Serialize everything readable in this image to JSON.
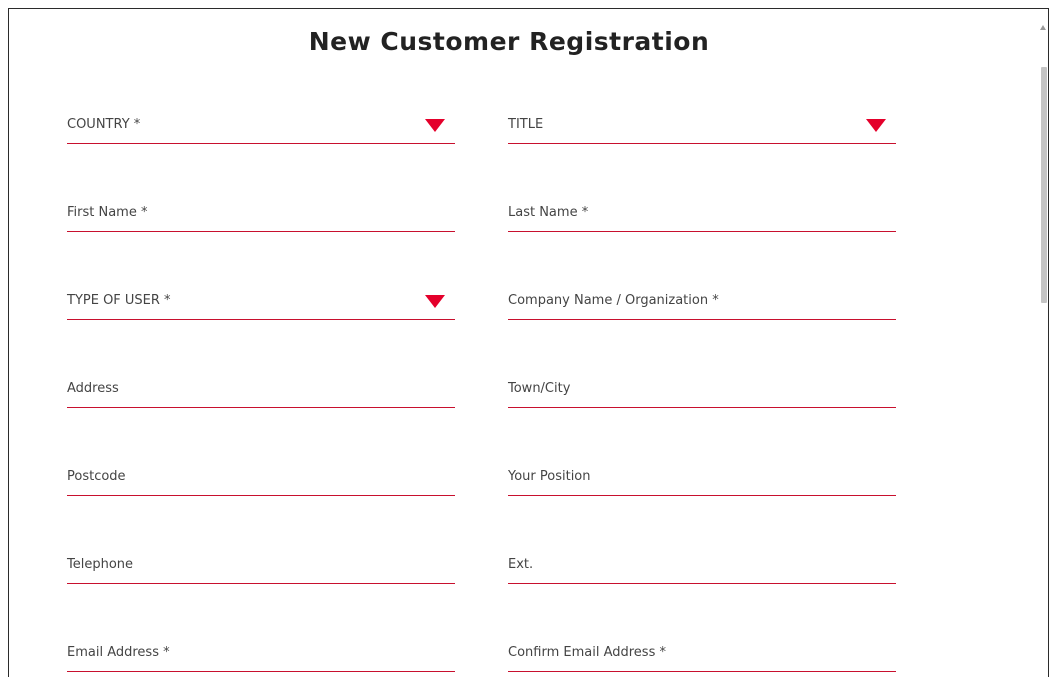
{
  "form": {
    "title": "New Customer Registration",
    "accent_color": "#e4002b",
    "fields": {
      "country": {
        "label": "COUNTRY *",
        "type": "select",
        "icon": "dropdown-arrow-icon"
      },
      "title": {
        "label": "TITLE",
        "type": "select",
        "icon": "dropdown-arrow-icon"
      },
      "first_name": {
        "label": "First Name *",
        "type": "text"
      },
      "last_name": {
        "label": "Last Name *",
        "type": "text"
      },
      "type_of_user": {
        "label": "TYPE OF USER *",
        "type": "select",
        "icon": "dropdown-arrow-icon"
      },
      "company": {
        "label": "Company Name / Organization *",
        "type": "text"
      },
      "address": {
        "label": "Address",
        "type": "text"
      },
      "town_city": {
        "label": "Town/City",
        "type": "text"
      },
      "postcode": {
        "label": "Postcode",
        "type": "text"
      },
      "position": {
        "label": "Your Position",
        "type": "text"
      },
      "telephone": {
        "label": "Telephone",
        "type": "text"
      },
      "ext": {
        "label": "Ext.",
        "type": "text"
      },
      "email": {
        "label": "Email Address *",
        "type": "text"
      },
      "confirm_email": {
        "label": "Confirm Email Address *",
        "type": "text"
      }
    }
  }
}
